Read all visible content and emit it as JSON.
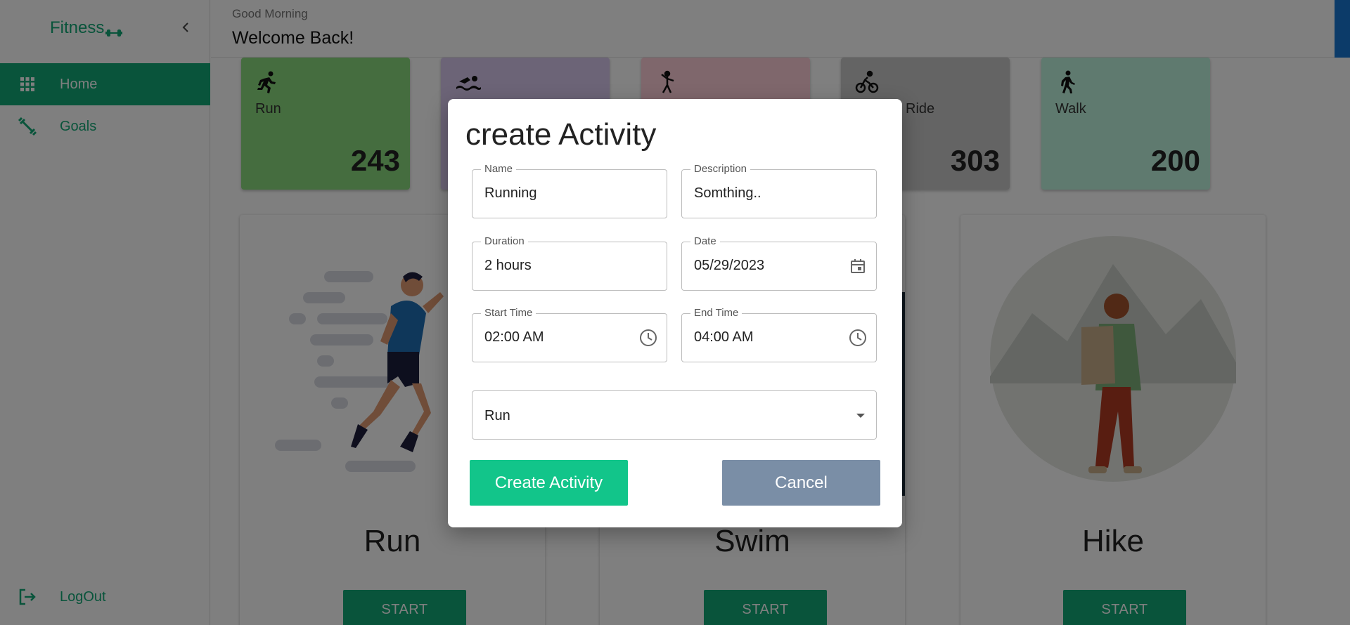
{
  "sidebar": {
    "brand": "Fitness",
    "items": [
      {
        "label": "Home"
      },
      {
        "label": "Goals"
      }
    ],
    "logout_label": "LogOut"
  },
  "header": {
    "greeting": "Good Morning",
    "welcome": "Welcome Back!"
  },
  "stats": [
    {
      "label": "Run",
      "value": "243",
      "color": "#8bdb7e"
    },
    {
      "label": "",
      "value": "",
      "color": "#d9c8ee"
    },
    {
      "label": "",
      "value": "",
      "color": "#ffcfd9"
    },
    {
      "label": "Ride",
      "value": "303",
      "color": "#c9c9c9"
    },
    {
      "label": "Walk",
      "value": "200",
      "color": "#bff5de"
    }
  ],
  "activities": [
    {
      "title": "Run",
      "button": "START"
    },
    {
      "title": "Swim",
      "button": "START"
    },
    {
      "title": "Hike",
      "button": "START"
    }
  ],
  "modal": {
    "title": "create Activity",
    "fields": {
      "name": {
        "label": "Name",
        "value": "Running"
      },
      "description": {
        "label": "Description",
        "value": "Somthing.."
      },
      "duration": {
        "label": "Duration",
        "value": "2 hours"
      },
      "date": {
        "label": "Date",
        "value": "05/29/2023"
      },
      "start_time": {
        "label": "Start Time",
        "value": "02:00 AM"
      },
      "end_time": {
        "label": "End Time",
        "value": "04:00 AM"
      },
      "type": {
        "value": "Run"
      }
    },
    "create_label": "Create Activity",
    "cancel_label": "Cancel"
  },
  "colors": {
    "primary": "#12a876",
    "create_button": "#12c58a",
    "cancel_button": "#7a8ea6"
  },
  "icons": [
    "dumbbell-icon",
    "chevron-left-icon",
    "grid-icon",
    "dumbbell-diagonal-icon",
    "logout-icon",
    "run-icon",
    "swim-icon",
    "dance-icon",
    "bike-icon",
    "walk-icon",
    "calendar-icon",
    "clock-icon",
    "dropdown-caret-icon"
  ]
}
